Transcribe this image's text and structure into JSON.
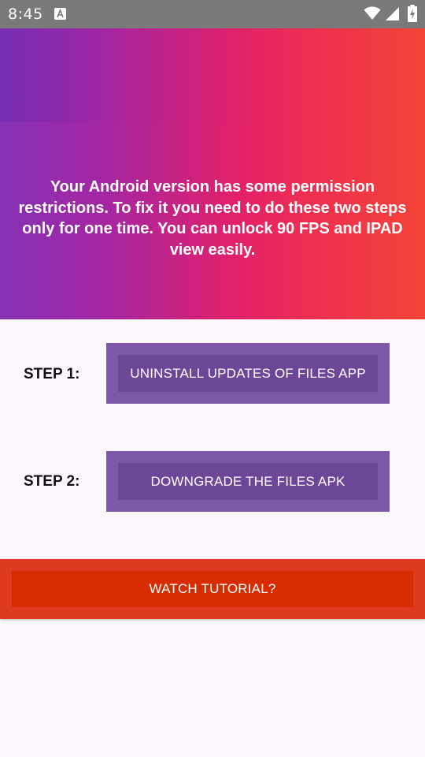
{
  "status_bar": {
    "time": "8:45",
    "icons": [
      "notification-a-icon",
      "wifi-icon",
      "signal-icon",
      "battery-charging-icon"
    ]
  },
  "banner": {
    "message": "Your Android version has some permission restrictions. To fix it you need to do these two steps only for one time. You can unlock 90 FPS and IPAD view easily."
  },
  "steps": [
    {
      "label": "STEP 1:",
      "button": "UNINSTALL UPDATES OF FILES APP"
    },
    {
      "label": "STEP 2:",
      "button": "DOWNGRADE THE FILES APK"
    }
  ],
  "tutorial": {
    "label": "WATCH TUTORIAL?"
  },
  "colors": {
    "status_bar": "#7a7a7a",
    "gradient_start": "#8531b4",
    "gradient_mid": "#e2206b",
    "gradient_end": "#f44336",
    "background": "#fcf6fd",
    "step_button_outer": "#7e57a8",
    "step_button_inner": "#6e4698",
    "tutorial_outer": "#de3a1f",
    "tutorial_inner": "#d62c00"
  }
}
